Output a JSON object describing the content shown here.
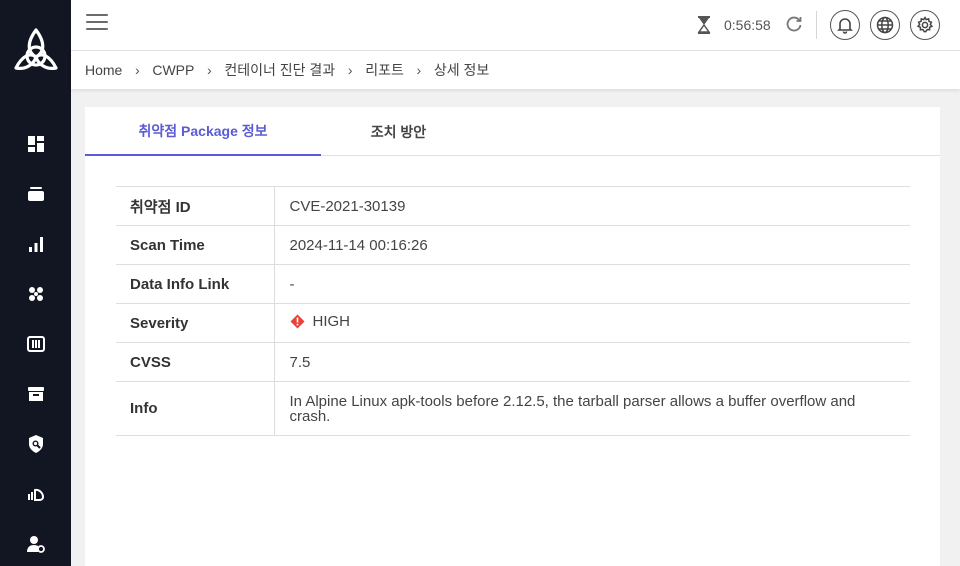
{
  "sidebar": {
    "logo": "triquetra-logo",
    "items": [
      {
        "icon": "dashboard-icon"
      },
      {
        "icon": "layers-icon"
      },
      {
        "icon": "bar-chart-icon"
      },
      {
        "icon": "cluster-icon"
      },
      {
        "icon": "server-icon"
      },
      {
        "icon": "archive-icon"
      },
      {
        "icon": "shield-search-icon"
      },
      {
        "icon": "cloud-icon"
      },
      {
        "icon": "user-settings-icon"
      }
    ]
  },
  "header": {
    "timer": "0:56:58",
    "buttons": [
      "bell-icon",
      "globe-icon",
      "gear-icon"
    ]
  },
  "breadcrumb": [
    "Home",
    "CWPP",
    "컨테이너 진단 결과",
    "리포트",
    "상세 정보"
  ],
  "tabs": [
    {
      "label": "취약점 Package 정보",
      "active": true
    },
    {
      "label": "조치 방안",
      "active": false
    }
  ],
  "details": {
    "rows": [
      {
        "label": "취약점 ID",
        "value": "CVE-2021-30139"
      },
      {
        "label": "Scan Time",
        "value": "2024-11-14 00:16:26"
      },
      {
        "label": "Data Info Link",
        "value": "-"
      },
      {
        "label": "Severity",
        "value": "HIGH"
      },
      {
        "label": "CVSS",
        "value": "7.5"
      },
      {
        "label": "Info",
        "value": "In Alpine Linux apk-tools before 2.12.5, the tarball parser allows a buffer overflow and crash."
      }
    ]
  },
  "colors": {
    "sidebar": "#121522",
    "accent": "#5b5bd6",
    "severity_high": "#e8433a"
  }
}
